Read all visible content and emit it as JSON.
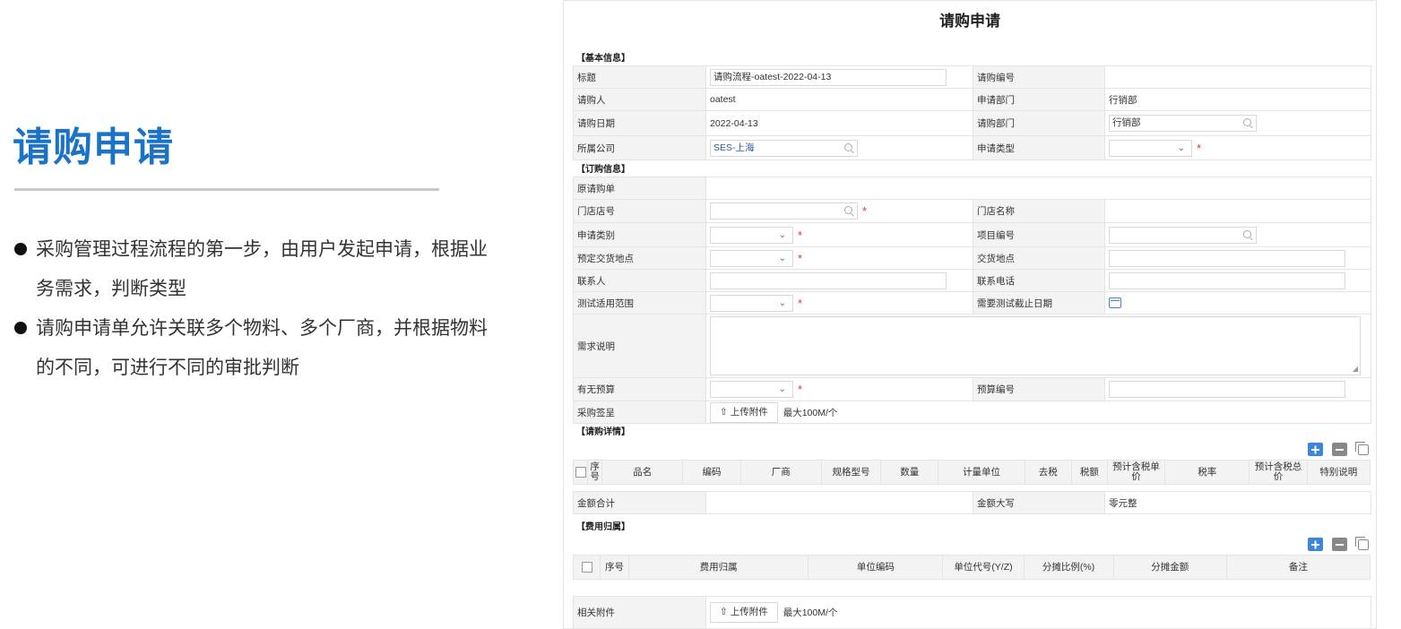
{
  "slide": {
    "title": "请购申请",
    "bullets": [
      "采购管理过程流程的第一步，由用户发起申请，根据业务需求，判断类型",
      "请购申请单允许关联多个物料、多个厂商，并根据物料的不同，可进行不同的审批判断"
    ]
  },
  "form": {
    "title": "请购申请",
    "sections": {
      "basic": "【基本信息】",
      "order": "【订购信息】",
      "detail": "【请购详情】",
      "cost": "【费用归属】"
    },
    "basic": {
      "title_label": "标题",
      "title_value": "请购流程-oatest-2022-04-13",
      "number_label": "请购编号",
      "number_value": "",
      "requester_label": "请购人",
      "requester_value": "oatest",
      "dept_label": "申请部门",
      "dept_value": "行销部",
      "date_label": "请购日期",
      "date_value": "2022-04-13",
      "req_dept_label": "请购部门",
      "req_dept_value": "行销部",
      "company_label": "所属公司",
      "company_value": "SES-上海",
      "type_label": "申请类型",
      "type_value": ""
    },
    "order": {
      "orig_label": "原请购单",
      "store_no_label": "门店店号",
      "store_name_label": "门店名称",
      "category_label": "申请类别",
      "project_no_label": "项目编号",
      "planned_loc_label": "预定交货地点",
      "delivery_loc_label": "交货地点",
      "contact_label": "联系人",
      "phone_label": "联系电话",
      "test_scope_label": "测试适用范围",
      "test_deadline_label": "需要测试截止日期",
      "desc_label": "需求说明",
      "budget_label": "有无预算",
      "budget_no_label": "预算编号",
      "sign_label": "采购签呈",
      "upload_label": "上传附件",
      "upload_hint": "最大100M/个"
    },
    "detail": {
      "columns": [
        "序号",
        "品名",
        "编码",
        "厂商",
        "规格型号",
        "数量",
        "计量单位",
        "去税",
        "税额",
        "预计含税单价",
        "税率",
        "预计含税总价",
        "特别说明"
      ],
      "total_label": "金额合计",
      "total_value": "",
      "total_caps_label": "金额大写",
      "total_caps_value": "零元整"
    },
    "cost": {
      "columns": [
        "序号",
        "费用归属",
        "单位编码",
        "单位代号(Y/Z)",
        "分摊比例(%)",
        "分摊金额",
        "备注"
      ],
      "attach_label": "相关附件",
      "upload_label": "上传附件",
      "upload_hint": "最大100M/个"
    },
    "colors": {
      "accent": "#1a73c8",
      "link": "#2a5a9c",
      "required": "#e33333",
      "label_bg": "#f3f3f3"
    },
    "icons": [
      "search-icon",
      "chevron-down-icon",
      "calendar-icon",
      "upload-icon",
      "add-icon",
      "remove-icon",
      "copy-icon"
    ]
  }
}
